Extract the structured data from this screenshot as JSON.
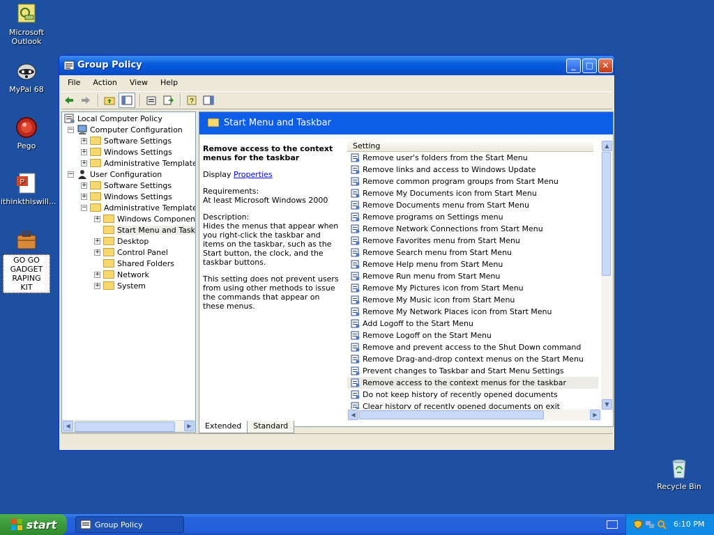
{
  "desktop": {
    "icons": [
      {
        "label": "Microsoft Outlook"
      },
      {
        "label": "MyPal 68"
      },
      {
        "label": "Pego"
      },
      {
        "label": "ithinkthiswill..."
      },
      {
        "label": "GO GO GADGET RAPING KIT"
      },
      {
        "label": "Recycle Bin"
      }
    ]
  },
  "window": {
    "title": "Group Policy",
    "menu": [
      "File",
      "Action",
      "View",
      "Help"
    ]
  },
  "tree": {
    "items": [
      {
        "label": "Local Computer Policy"
      },
      {
        "label": "Computer Configuration"
      },
      {
        "label": "Software Settings"
      },
      {
        "label": "Windows Settings"
      },
      {
        "label": "Administrative Templates"
      },
      {
        "label": "User Configuration"
      },
      {
        "label": "Software Settings"
      },
      {
        "label": "Windows Settings"
      },
      {
        "label": "Administrative Templates"
      },
      {
        "label": "Windows Components"
      },
      {
        "label": "Start Menu and Taskbar"
      },
      {
        "label": "Desktop"
      },
      {
        "label": "Control Panel"
      },
      {
        "label": "Shared Folders"
      },
      {
        "label": "Network"
      },
      {
        "label": "System"
      }
    ]
  },
  "detail": {
    "header": "Start Menu and Taskbar",
    "title": "Remove access to the context menus for the taskbar",
    "display_prefix": "Display",
    "display_link": "Properties",
    "requirements_label": "Requirements:",
    "requirements_value": "At least Microsoft Windows 2000",
    "description_label": "Description:",
    "description_1": "Hides the menus that appear when you right-click the taskbar and items on the taskbar, such as the Start button, the clock, and the taskbar buttons.",
    "description_2": "This setting does not prevent users from using other methods to issue the commands that appear on these menus."
  },
  "list": {
    "column": "Setting",
    "rows": [
      "Remove user's folders from the Start Menu",
      "Remove links and access to Windows Update",
      "Remove common program groups from Start Menu",
      "Remove My Documents icon from Start Menu",
      "Remove Documents menu from Start Menu",
      "Remove programs on Settings menu",
      "Remove Network Connections from Start Menu",
      "Remove Favorites menu from Start Menu",
      "Remove Search menu from Start Menu",
      "Remove Help menu from Start Menu",
      "Remove Run menu from Start Menu",
      "Remove My Pictures icon from Start Menu",
      "Remove My Music icon from Start Menu",
      "Remove My Network Places icon from Start Menu",
      "Add Logoff to the Start Menu",
      "Remove Logoff on the Start Menu",
      "Remove and prevent access to the Shut Down command",
      "Remove Drag-and-drop context menus on the Start Menu",
      "Prevent changes to Taskbar and Start Menu Settings",
      "Remove access to the context menus for the taskbar",
      "Do not keep history of recently opened documents",
      "Clear history of recently opened documents on exit"
    ]
  },
  "tabs": [
    "Extended",
    "Standard"
  ],
  "taskbar": {
    "start": "start",
    "task": "Group Policy",
    "clock": "6:10 PM"
  }
}
